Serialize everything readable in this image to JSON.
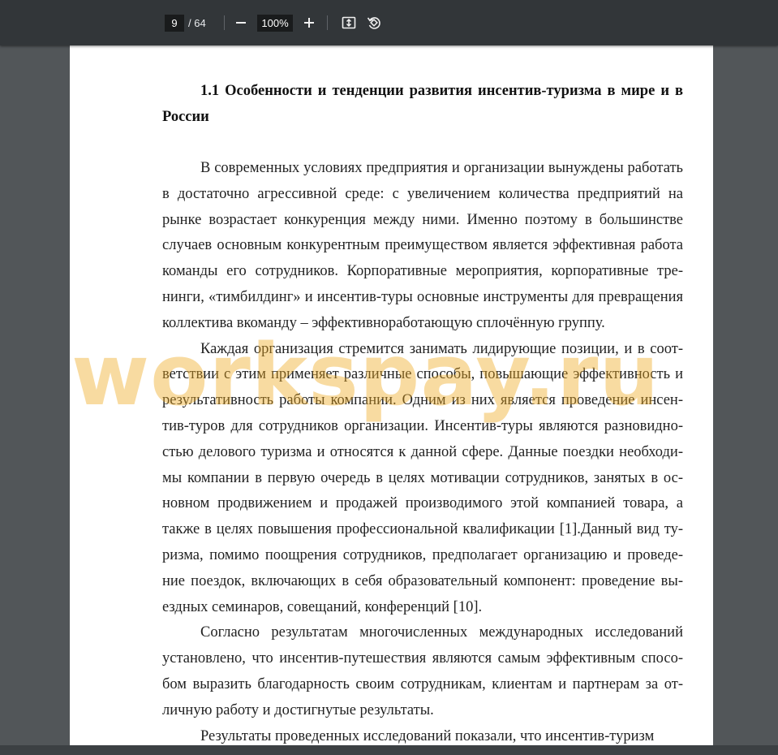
{
  "toolbar": {
    "current_page": "9",
    "page_total": "/ 64",
    "zoom": "100%",
    "zoom_out_icon": "minus-icon",
    "zoom_in_icon": "plus-icon",
    "fit_icon": "fit-page-icon",
    "rotate_icon": "rotate-icon"
  },
  "document": {
    "heading": "1.1 Особенности и тенденции развития инсентив-туризма в мире и в России",
    "paragraphs": [
      "В современных условиях предприятия и организации вынуждены рабо­тать в достаточно агрессивной среде: с увеличением количества предприятий на рынке возрастает конкуренция между ними. Именно поэтому в большинстве случаев основным конкурентным преимуществом является эффективная работа команды его сотрудников. Корпоративные мероприятия, корпоративные тре­нинги, «тимбилдинг» и инсентив-туры основные инструменты для превраще­ния коллектива вкоманду – эффективноработающую сплочённую группу.",
      "Каждая организация стремится занимать лидирующие позиции, и в соот­ветствии с этим применяет различные способы, повышающие эффективность и результативность работы компании. Одним из них является проведение инсен­тив-туров для сотрудников организации. Инсентив-туры являются разновидно­стью делового туризма и относятся к данной сфере. Данные поездки необходи­мы компании в первую очередь в целях мотивации сотрудников, занятых в ос­новном продвижением и продажей производимого этой компанией товара, а также в целях повышения профессиональной квалификации [1].Данный вид ту­ризма, помимо поощрения сотрудников, предполагает организацию и проведе­ние поездок, включающих в себя образовательный компонент: проведение вы­ездных семинаров, совещаний, конференций [10].",
      "Согласно результатам многочисленных международных исследований установлено, что инсентив-путешествия являются самым эффективным спосо­бом выразить благодарность своим сотрудникам, клиентам и партнерам за от­личную работу и достигнутые результаты.",
      "Результаты проведенных исследований показали, что инсентив-туризм"
    ]
  },
  "watermark": {
    "text": "workspay.ru",
    "color": "#eeaa1e"
  },
  "colors": {
    "toolbar_bg": "#323639",
    "viewer_bg": "#525659",
    "paper_bg": "#ffffff"
  }
}
